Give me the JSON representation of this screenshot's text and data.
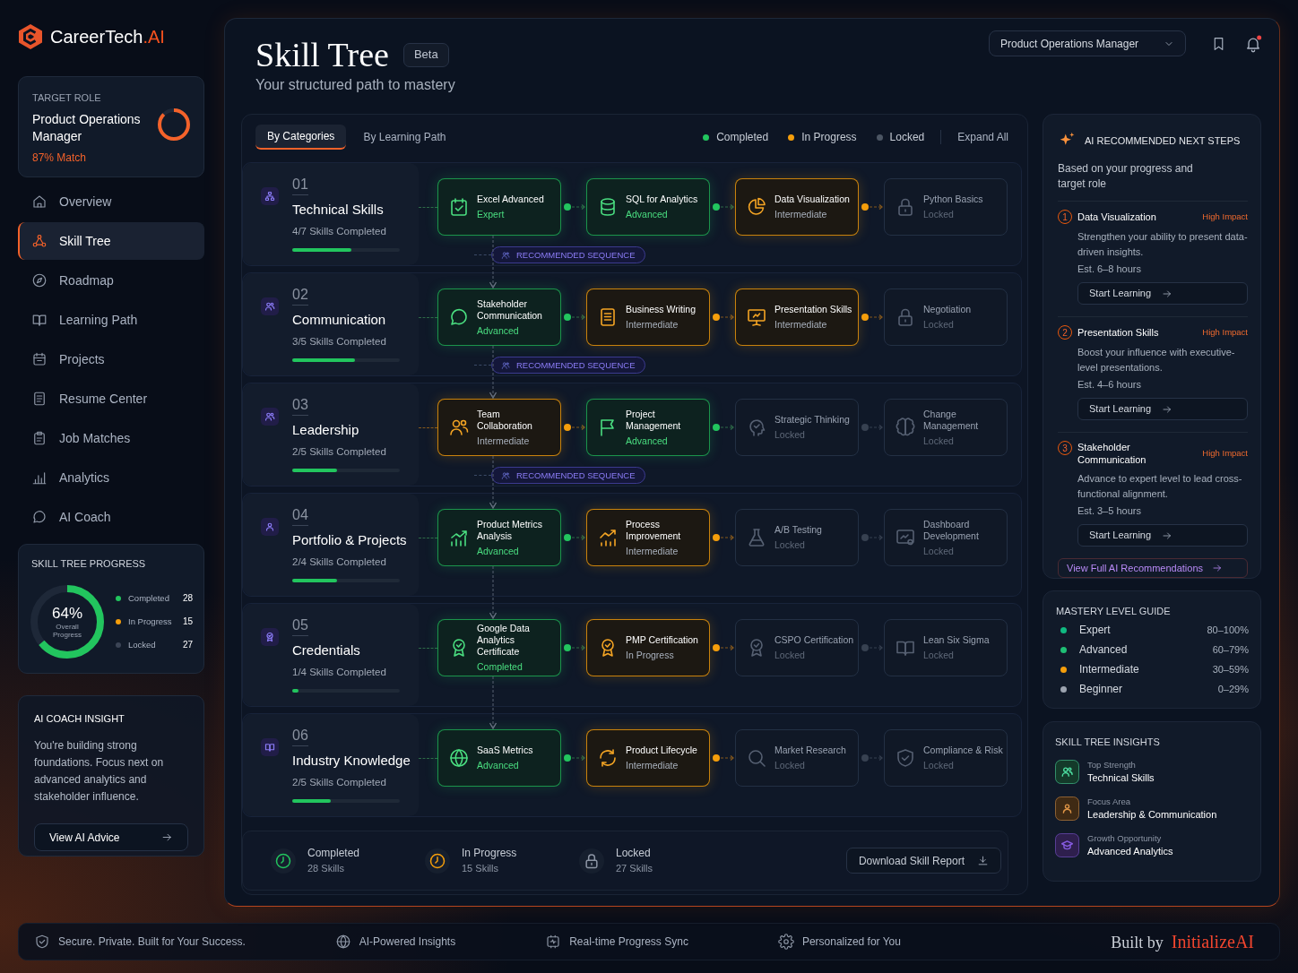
{
  "brand": {
    "name": "CareerTech",
    "suffix": ".AI"
  },
  "target_role": {
    "label": "TARGET ROLE",
    "title": "Product Operations Manager",
    "match": "87% Match",
    "level": 0.87
  },
  "nav": [
    {
      "label": "Overview",
      "selected": false
    },
    {
      "label": "Skill Tree",
      "selected": true
    },
    {
      "label": "Roadmap",
      "selected": false
    },
    {
      "label": "Learning Path",
      "selected": false
    },
    {
      "label": "Projects",
      "selected": false
    },
    {
      "label": "Resume Center",
      "selected": false
    },
    {
      "label": "Job Matches",
      "selected": false
    },
    {
      "label": "Analytics",
      "selected": false
    },
    {
      "label": "AI Coach",
      "selected": false
    }
  ],
  "skill_tree_progress": {
    "title": "SKILL TREE PROGRESS",
    "value": "64%",
    "caption": "Overall Progress",
    "level": 0.64,
    "legend": [
      {
        "label": "Completed",
        "count": "28",
        "color": "#22c55e"
      },
      {
        "label": "In Progress",
        "count": "15",
        "color": "#f59e0b"
      },
      {
        "label": "Locked",
        "count": "27",
        "color": "#3b4455"
      }
    ]
  },
  "coach_insight": {
    "title": "AI COACH INSIGHT",
    "text": "You're building strong foundations. Focus next on advanced analytics and stakeholder influence.",
    "button": "View AI Advice"
  },
  "header": {
    "title": "Skill Tree",
    "badge": "Beta",
    "subtitle": "Your structured path to mastery",
    "role_select": "Product Operations Manager",
    "notification_dot": true
  },
  "view_tabs": [
    {
      "label": "By Categories",
      "selected": true
    },
    {
      "label": "By Learning Path",
      "selected": false
    }
  ],
  "status_legend": [
    {
      "label": "Completed",
      "color": "#22c55e"
    },
    {
      "label": "In Progress",
      "color": "#f59e0b"
    },
    {
      "label": "Locked",
      "color": "#4b5563"
    }
  ],
  "expand_all": "Expand All",
  "categories": [
    {
      "number": "01",
      "title": "Technical Skills",
      "skills_completed": "4/7 Skills Completed",
      "level": 0.55,
      "sequence_label": "RECOMMENDED SEQUENCE",
      "skills": [
        {
          "name": "Excel Advanced",
          "status": "Expert",
          "kind": "completed"
        },
        {
          "name": "SQL for Analytics",
          "status": "Advanced",
          "kind": "completed"
        },
        {
          "name": "Data Visualization",
          "status": "Intermediate",
          "kind": "in_progress"
        },
        {
          "name": "Python Basics",
          "status": "Locked",
          "kind": "locked"
        }
      ]
    },
    {
      "number": "02",
      "title": "Communication",
      "skills_completed": "3/5 Skills Completed",
      "level": 0.58,
      "sequence_label": "RECOMMENDED SEQUENCE",
      "skills": [
        {
          "name": "Stakeholder Communication",
          "status": "Advanced",
          "kind": "completed"
        },
        {
          "name": "Business Writing",
          "status": "Intermediate",
          "kind": "in_progress"
        },
        {
          "name": "Presentation Skills",
          "status": "Intermediate",
          "kind": "in_progress"
        },
        {
          "name": "Negotiation",
          "status": "Locked",
          "kind": "locked"
        }
      ]
    },
    {
      "number": "03",
      "title": "Leadership",
      "skills_completed": "2/5 Skills Completed",
      "level": 0.42,
      "sequence_label": "RECOMMENDED SEQUENCE",
      "skills": [
        {
          "name": "Team Collaboration",
          "status": "Intermediate",
          "kind": "in_progress"
        },
        {
          "name": "Project Management",
          "status": "Advanced",
          "kind": "completed"
        },
        {
          "name": "Strategic Thinking",
          "status": "Locked",
          "kind": "locked"
        },
        {
          "name": "Change Management",
          "status": "Locked",
          "kind": "locked"
        }
      ]
    },
    {
      "number": "04",
      "title": "Portfolio & Projects",
      "skills_completed": "2/4 Skills Completed",
      "level": 0.42,
      "skills": [
        {
          "name": "Product Metrics Analysis",
          "status": "Advanced",
          "kind": "completed"
        },
        {
          "name": "Process Improvement",
          "status": "Intermediate",
          "kind": "in_progress"
        },
        {
          "name": "A/B Testing",
          "status": "Locked",
          "kind": "locked"
        },
        {
          "name": "Dashboard Development",
          "status": "Locked",
          "kind": "locked"
        }
      ]
    },
    {
      "number": "05",
      "title": "Credentials",
      "skills_completed": "1/4 Skills Completed",
      "level": 0.06,
      "skills": [
        {
          "name": "Google Data Analytics Certificate",
          "status": "Completed",
          "kind": "completed"
        },
        {
          "name": "PMP Certification",
          "status": "In Progress",
          "kind": "in_progress"
        },
        {
          "name": "CSPO Certification",
          "status": "Locked",
          "kind": "locked"
        },
        {
          "name": "Lean Six Sigma",
          "status": "Locked",
          "kind": "locked"
        }
      ]
    },
    {
      "number": "06",
      "title": "Industry Knowledge",
      "skills_completed": "2/5 Skills Completed",
      "level": 0.36,
      "skills": [
        {
          "name": "SaaS Metrics",
          "status": "Advanced",
          "kind": "completed"
        },
        {
          "name": "Product Lifecycle",
          "status": "Intermediate",
          "kind": "in_progress"
        },
        {
          "name": "Market Research",
          "status": "Locked",
          "kind": "locked"
        },
        {
          "name": "Compliance & Risk",
          "status": "Locked",
          "kind": "locked"
        }
      ]
    }
  ],
  "summary": {
    "items": [
      {
        "kind": "completed",
        "label": "Completed",
        "count": "28 Skills"
      },
      {
        "kind": "in_progress",
        "label": "In Progress",
        "count": "15 Skills"
      },
      {
        "kind": "locked",
        "label": "Locked",
        "count": "27 Skills"
      }
    ],
    "button": "Download Skill Report"
  },
  "recommendations": {
    "title": "AI RECOMMENDED NEXT STEPS",
    "subtitle": "Based on your progress and target role",
    "items": [
      {
        "number": "1",
        "title": "Data Visualization",
        "impact": "High Impact",
        "description": "Strengthen your ability to present data-driven insights.",
        "estimate": "Est. 6–8 hours",
        "button": "Start Learning"
      },
      {
        "number": "2",
        "title": "Presentation Skills",
        "impact": "High Impact",
        "description": "Boost your influence with executive-level presentations.",
        "estimate": "Est. 4–6 hours",
        "button": "Start Learning"
      },
      {
        "number": "3",
        "title": "Stakeholder Communication",
        "impact": "High Impact",
        "description": "Advance to expert level to lead cross-functional alignment.",
        "estimate": "Est. 3–5 hours",
        "button": "Start Learning"
      }
    ],
    "link": "View Full AI Recommendations"
  },
  "mastery_guide": {
    "title": "MASTERY LEVEL GUIDE",
    "levels": [
      {
        "label": "Expert",
        "range": "80–100%",
        "color": "#10b981"
      },
      {
        "label": "Advanced",
        "range": "60–79%",
        "color": "#1fbf75"
      },
      {
        "label": "Intermediate",
        "range": "30–59%",
        "color": "#f59e0b"
      },
      {
        "label": "Beginner",
        "range": "0–29%",
        "color": "#9ca3af"
      }
    ]
  },
  "insights": {
    "title": "SKILL TREE INSIGHTS",
    "items": [
      {
        "label": "Top Strength",
        "value": "Technical Skills",
        "color": "#143a2a"
      },
      {
        "label": "Focus Area",
        "value": "Leadership & Communication",
        "color": "#3f2a14"
      },
      {
        "label": "Growth Opportunity",
        "value": "Advanced Analytics",
        "color": "#2e1f4d"
      }
    ]
  },
  "footer": {
    "items": [
      "Secure. Private. Built for Your Success.",
      "AI-Powered Insights",
      "Real-time Progress Sync",
      "Personalized for You"
    ],
    "built_by": "Built by",
    "brand": "InitializeAI"
  }
}
